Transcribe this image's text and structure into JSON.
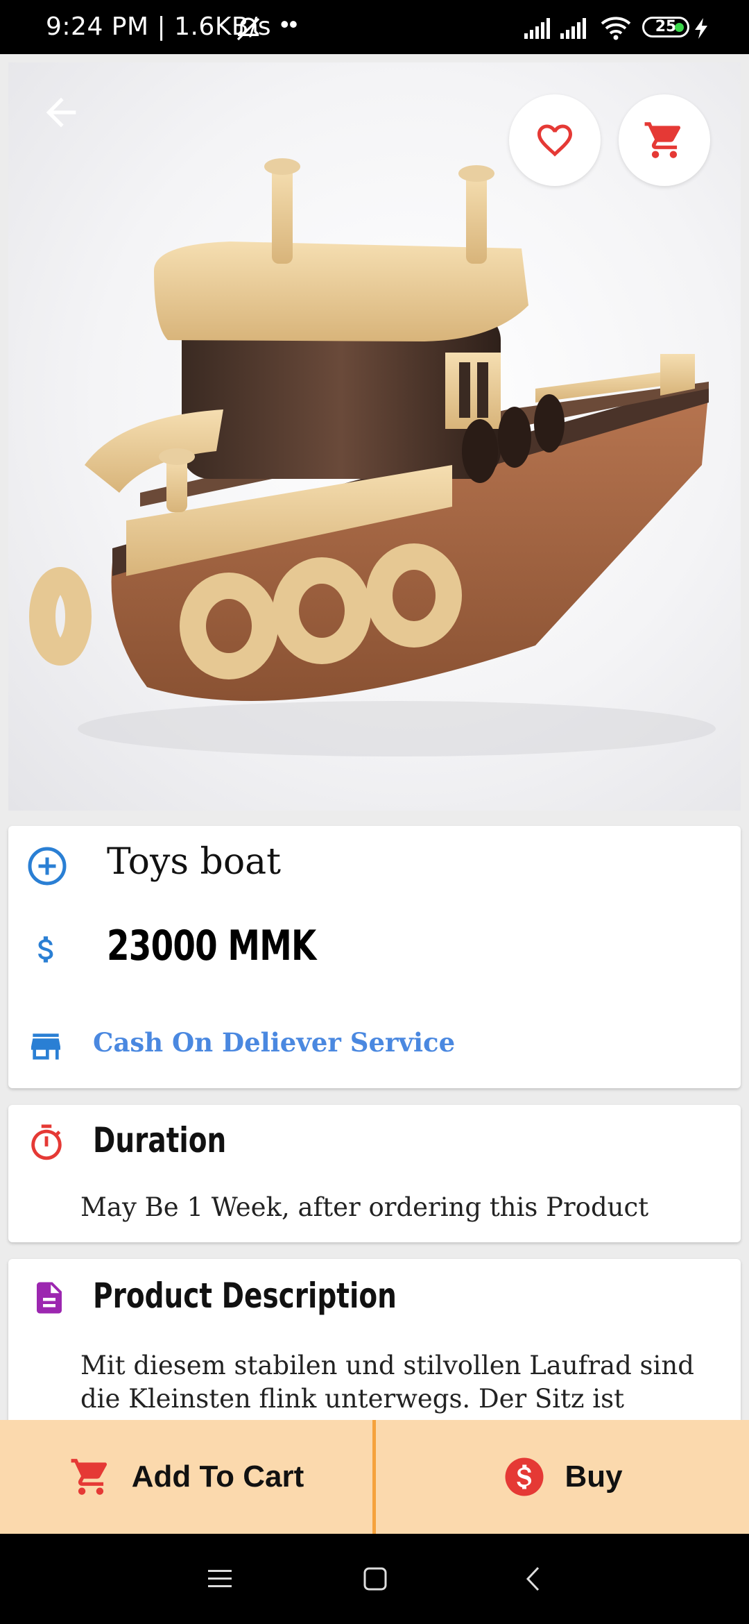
{
  "status_bar": {
    "time_speed": "9:24 PM | 1.6KB/s",
    "dots": "••",
    "battery": "25"
  },
  "hero": {
    "image_alt": "Wooden toy tugboat",
    "icons": {
      "back": "arrow-left-icon",
      "favorite": "heart-outline-icon",
      "cart": "shopping-cart-icon"
    }
  },
  "product": {
    "name": "Toys boat",
    "price": "23000 MMK",
    "service": "Cash On Deliever Service",
    "icons": {
      "name": "plus-circle-icon",
      "price": "dollar-icon",
      "service": "store-icon"
    }
  },
  "duration": {
    "heading": "Duration",
    "text": "May Be 1 Week, after ordering this Product",
    "icon": "timer-icon"
  },
  "description": {
    "heading": "Product Description",
    "text": "Mit diesem stabilen und stilvollen Laufrad sind die Kleinsten flink unterwegs. Der Sitz ist",
    "icon": "document-icon"
  },
  "actions": {
    "add_to_cart": "Add To Cart",
    "buy": "Buy"
  },
  "colors": {
    "accent_red": "#e53935",
    "link_blue": "#4a88e0",
    "bar_bg": "#fbd9ad",
    "divider": "#f5a23c",
    "desc_icon": "#9c27b0"
  }
}
